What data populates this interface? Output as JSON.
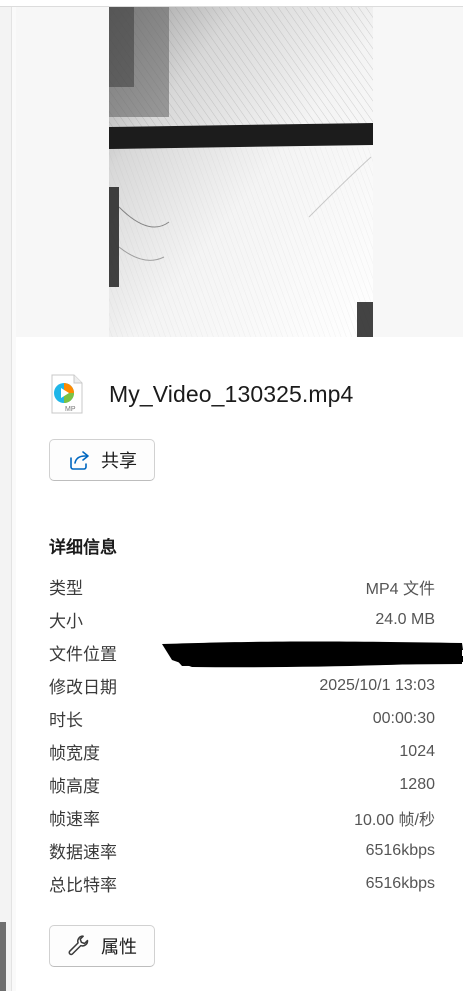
{
  "file": {
    "name": "My_Video_130325.mp4",
    "icon": "mp4-file-icon",
    "icon_badge": "MP"
  },
  "share_button": {
    "label": "共享",
    "icon": "share-icon"
  },
  "details": {
    "title": "详细信息",
    "rows": [
      {
        "key": "类型",
        "value": "MP4 文件"
      },
      {
        "key": "大小",
        "value": "24.0 MB"
      },
      {
        "key": "文件位置",
        "value": ""
      },
      {
        "key": "修改日期",
        "value": "2025/10/1 13:03"
      },
      {
        "key": "时长",
        "value": "00:00:30"
      },
      {
        "key": "帧宽度",
        "value": "1024"
      },
      {
        "key": "帧高度",
        "value": "1280"
      },
      {
        "key": "帧速率",
        "value": "10.00 帧/秒"
      },
      {
        "key": "数据速率",
        "value": "6516kbps"
      },
      {
        "key": "总比特率",
        "value": "6516kbps"
      }
    ]
  },
  "properties_button": {
    "label": "属性",
    "icon": "wrench-icon"
  },
  "colors": {
    "accent": "#0078d4",
    "panel_bg": "#f7f7f7",
    "text": "#1b1b1b",
    "secondary_text": "#555555"
  }
}
